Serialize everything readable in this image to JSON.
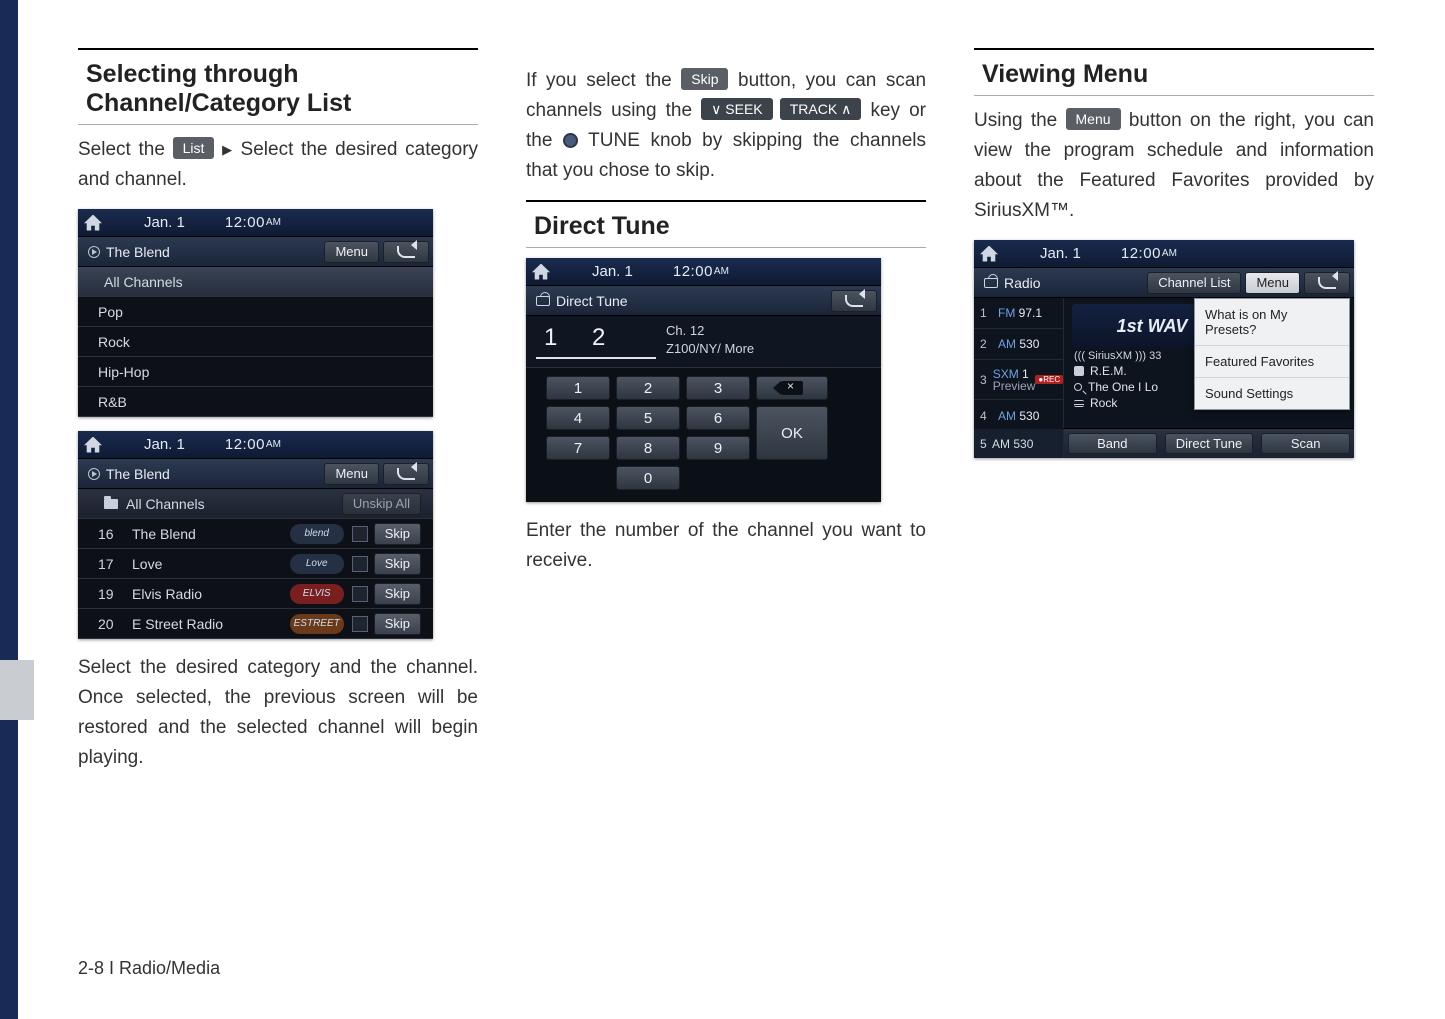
{
  "footer": "2-8 I Radio/Media",
  "col1": {
    "heading": "Selecting through Channel/Category List",
    "para1_a": "Select the ",
    "list_btn": "List",
    "para1_b": " Select the desired category and channel.",
    "para2": "Select the desired category and the channel. Once selected, the previous screen will be restored and the selected channel will begin playing.",
    "screen1": {
      "date": "Jan.  1",
      "time": "12:00",
      "ampm": "AM",
      "title": "The Blend",
      "menu": "Menu",
      "header": "All Channels",
      "cats": [
        "Pop",
        "Rock",
        "Hip-Hop",
        "R&B"
      ]
    },
    "screen2": {
      "date": "Jan.  1",
      "time": "12:00",
      "ampm": "AM",
      "title": "The Blend",
      "menu": "Menu",
      "header": "All Channels",
      "unskip": "Unskip All",
      "rows": [
        {
          "num": "16",
          "name": "The Blend",
          "logo": "blend",
          "skip": "Skip"
        },
        {
          "num": "17",
          "name": "Love",
          "logo": "Love",
          "skip": "Skip"
        },
        {
          "num": "19",
          "name": "Elvis Radio",
          "logo": "ELVIS",
          "skip": "Skip"
        },
        {
          "num": "20",
          "name": "E Street Radio",
          "logo": "ESTREET",
          "skip": "Skip"
        }
      ]
    }
  },
  "col2": {
    "para1_a": "If you select the ",
    "skip_btn": "Skip",
    "para1_b": " button, you can scan channels using the ",
    "seek_btn": "∨ SEEK",
    "track_btn": "TRACK ∧",
    "para1_c": " key or the ",
    "tune_label": " TUNE",
    "para1_d": " knob by skipping the channels that you chose to skip.",
    "heading": "Direct Tune",
    "para2": "Enter the number of the channel you want to receive.",
    "screen": {
      "date": "Jan.  1",
      "time": "12:00",
      "ampm": "AM",
      "title": "Direct Tune",
      "entry": "1 2",
      "info1": "Ch. 12",
      "info2": "Z100/NY/ More",
      "keys": [
        "1",
        "2",
        "3",
        "4",
        "5",
        "6",
        "7",
        "8",
        "9",
        "0"
      ],
      "ok": "OK"
    }
  },
  "col3": {
    "heading": "Viewing Menu",
    "para1_a": "Using the ",
    "menu_btn": "Menu",
    "para1_b": " button on the right, you can view the program schedule and information about the Featured Favorites provided by SiriusXM™.",
    "screen": {
      "date": "Jan.  1",
      "time": "12:00",
      "ampm": "AM",
      "title": "Radio",
      "chlist": "Channel List",
      "menu": "Menu",
      "presets": [
        {
          "n": "1",
          "band": "FM",
          "val": "97.1"
        },
        {
          "n": "2",
          "band": "AM",
          "val": "530"
        },
        {
          "n": "3",
          "band": "SXM",
          "val": "1",
          "sub": "Preview",
          "rec": "●REC"
        },
        {
          "n": "4",
          "band": "AM",
          "val": "530"
        }
      ],
      "preset5": {
        "n": "5",
        "band": "AM",
        "val": "530"
      },
      "art": "1st WAV",
      "sxm": "((( SiriusXM ))) 33",
      "artist": "R.E.M.",
      "track": "The One I Lo",
      "genre": "Rock",
      "menu_items": [
        "What is on My Presets?",
        "Featured Favorites",
        "Sound Settings"
      ],
      "bottom": [
        "Band",
        "Direct Tune",
        "Scan"
      ]
    }
  }
}
